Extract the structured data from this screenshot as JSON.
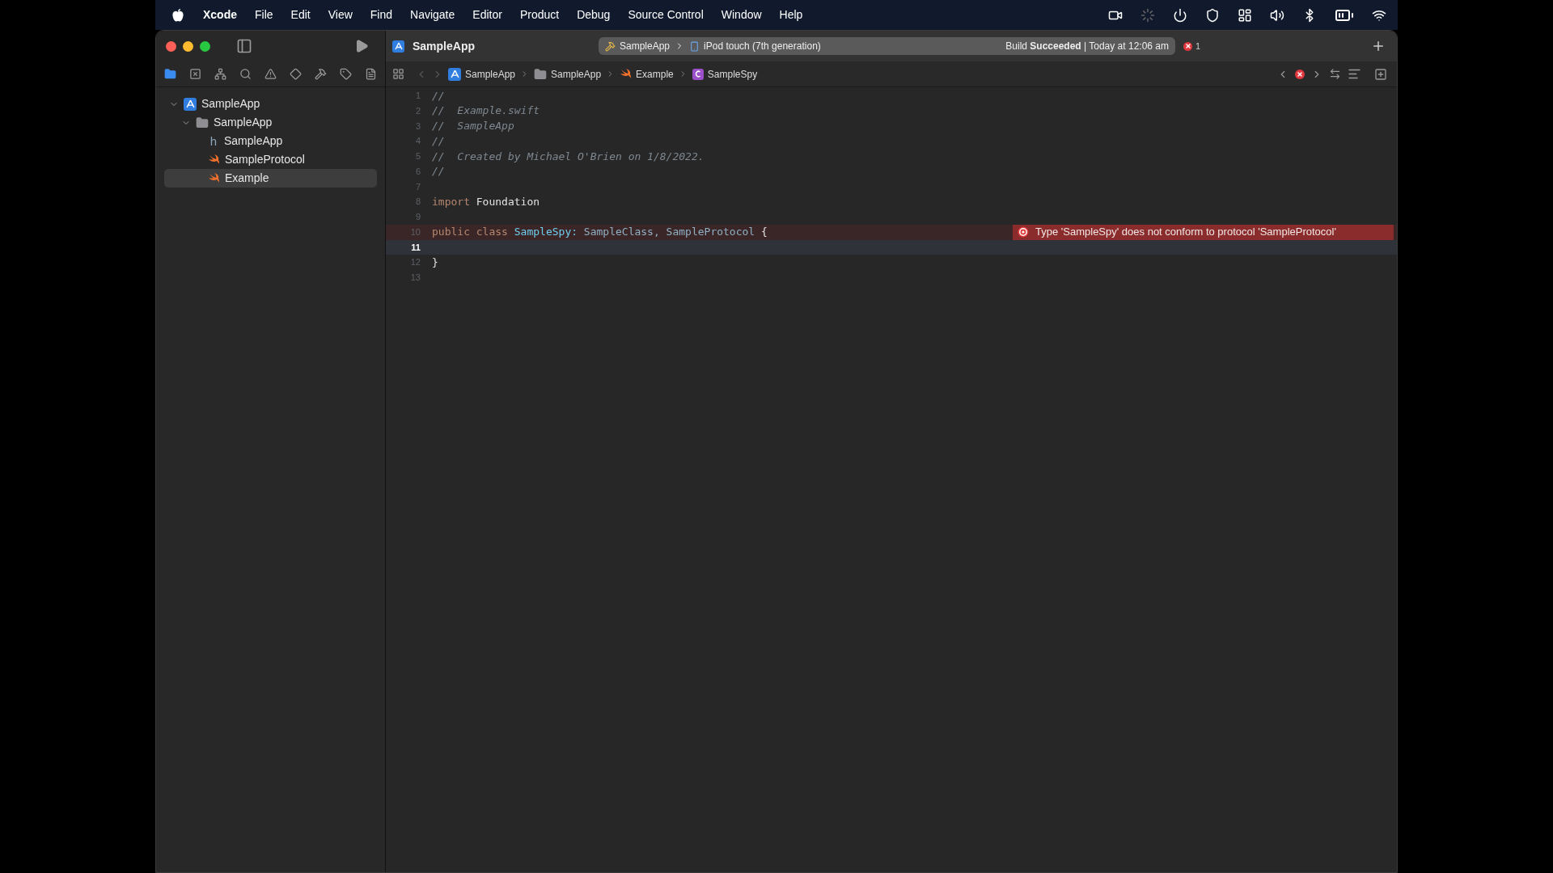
{
  "menu_bar": {
    "items": [
      {
        "label": "Xcode",
        "kind": "app"
      },
      {
        "label": "File",
        "kind": "menu"
      },
      {
        "label": "Edit",
        "kind": "menu"
      },
      {
        "label": "View",
        "kind": "menu"
      },
      {
        "label": "Find",
        "kind": "menu"
      },
      {
        "label": "Navigate",
        "kind": "menu"
      },
      {
        "label": "Editor",
        "kind": "menu"
      },
      {
        "label": "Product",
        "kind": "menu"
      },
      {
        "label": "Debug",
        "kind": "menu"
      },
      {
        "label": "Source Control",
        "kind": "menu"
      },
      {
        "label": "Window",
        "kind": "menu"
      },
      {
        "label": "Help",
        "kind": "menu"
      }
    ]
  },
  "toolbar": {
    "title": "SampleApp",
    "scheme": "SampleApp",
    "destination": "iPod touch (7th generation)",
    "status": "Build **Succeeded** | Today at 12:06 am",
    "error_count": "1"
  },
  "navigator": {
    "tree": [
      {
        "label": "SampleApp",
        "kind": "project",
        "expanded": true,
        "selected": false,
        "children": [
          {
            "label": "SampleApp",
            "kind": "folder",
            "expanded": true,
            "selected": false,
            "children": [
              {
                "label": "SampleApp",
                "kind": "header",
                "icon_glyph": "h",
                "selected": false
              },
              {
                "label": "SampleProtocol",
                "kind": "swift",
                "selected": false
              },
              {
                "label": "Example",
                "kind": "swift",
                "selected": true
              }
            ]
          }
        ]
      }
    ]
  },
  "jump_bar": [
    {
      "label": "SampleApp",
      "kind": "project"
    },
    {
      "label": "SampleApp",
      "kind": "folder"
    },
    {
      "label": "Example",
      "kind": "swift"
    },
    {
      "label": "SampleSpy",
      "kind": "class"
    }
  ],
  "code": {
    "lines": [
      {
        "number": "1",
        "current": false,
        "error": false,
        "tokens": [
          {
            "text": "//",
            "kind": "comment"
          }
        ]
      },
      {
        "number": "2",
        "current": false,
        "error": false,
        "tokens": [
          {
            "text": "//  Example.swift",
            "kind": "comment"
          }
        ]
      },
      {
        "number": "3",
        "current": false,
        "error": false,
        "tokens": [
          {
            "text": "//  SampleApp",
            "kind": "comment"
          }
        ]
      },
      {
        "number": "4",
        "current": false,
        "error": false,
        "tokens": [
          {
            "text": "//",
            "kind": "comment"
          }
        ]
      },
      {
        "number": "5",
        "current": false,
        "error": false,
        "tokens": [
          {
            "text": "//  Created by Michael O'Brien on 1/8/2022.",
            "kind": "comment"
          }
        ]
      },
      {
        "number": "6",
        "current": false,
        "error": false,
        "tokens": [
          {
            "text": "//",
            "kind": "comment"
          }
        ]
      },
      {
        "number": "7",
        "current": false,
        "error": false
      },
      {
        "number": "8",
        "current": false,
        "error": false,
        "tokens": [
          {
            "text": "import",
            "kind": "keyword"
          },
          {
            "text": "Foundation",
            "kind": "plain"
          }
        ]
      },
      {
        "number": "9",
        "current": false,
        "error": false
      },
      {
        "number": "10",
        "current": false,
        "error": true,
        "message": "Type 'SampleSpy' does not conform to protocol 'SampleProtocol'",
        "tokens": [
          {
            "text": "public",
            "kind": "keyword"
          },
          {
            "text": "class",
            "kind": "keyword"
          },
          {
            "text": "SampleSpy:",
            "kind": "declaration"
          },
          {
            "text": "SampleClass,",
            "kind": "type"
          },
          {
            "text": "SampleProtocol",
            "kind": "type"
          },
          {
            "text": "{",
            "kind": "plain"
          }
        ]
      },
      {
        "number": "11",
        "current": true,
        "error": false
      },
      {
        "number": "12",
        "current": false,
        "error": false,
        "tokens": [
          {
            "text": "}",
            "kind": "plain"
          }
        ]
      },
      {
        "number": "13",
        "current": false,
        "error": false
      }
    ]
  }
}
